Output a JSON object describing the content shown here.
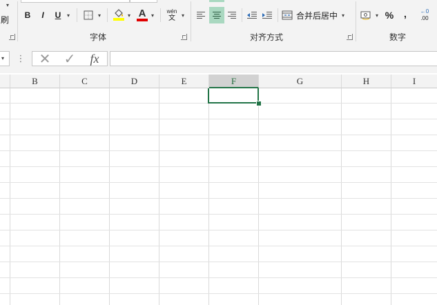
{
  "ribbon": {
    "clipboard_fragment": "刷",
    "font_group_label": "字体",
    "align_group_label": "对齐方式",
    "number_group_label": "数字",
    "bold": "B",
    "italic": "I",
    "underline": "U",
    "font_color_glyph": "A",
    "phonetic_top": "wén",
    "phonetic_bottom": "文",
    "merge_center_label": "合并后居中",
    "percent": "%",
    "comma": ",",
    "decimal_top": "←0",
    "decimal_bottom": ".00"
  },
  "formula_bar": {
    "dots": "⋮",
    "cancel": "✕",
    "enter": "✓",
    "fx": "fx",
    "value": ""
  },
  "sheet": {
    "columns": [
      "B",
      "C",
      "D",
      "E",
      "F",
      "G",
      "H",
      "I"
    ],
    "selected_column": "F"
  },
  "colors": {
    "accent": "#217346",
    "fill_yellow": "#ffff00",
    "font_red": "#e00000"
  }
}
